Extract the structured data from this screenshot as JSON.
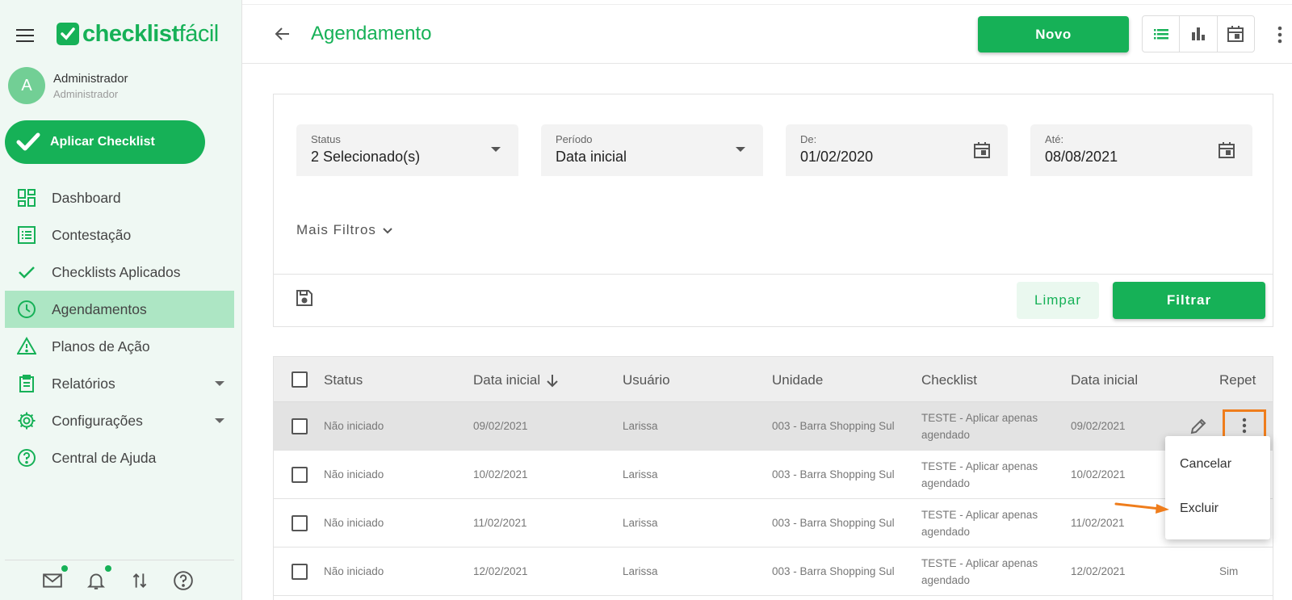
{
  "brand": {
    "name_bold": "checklist",
    "name_thin": "fácil",
    "color": "#16b157"
  },
  "profile": {
    "initial": "A",
    "name": "Administrador",
    "role": "Administrador"
  },
  "apply_button": {
    "label": "Aplicar Checklist"
  },
  "nav": {
    "items": [
      {
        "label": "Dashboard",
        "icon": "dashboard-icon"
      },
      {
        "label": "Contestação",
        "icon": "list-icon"
      },
      {
        "label": "Checklists Aplicados",
        "icon": "check-icon"
      },
      {
        "label": "Agendamentos",
        "icon": "clock-icon",
        "active": true
      },
      {
        "label": "Planos de Ação",
        "icon": "warning-icon"
      },
      {
        "label": "Relatórios",
        "icon": "clipboard-icon",
        "expandable": true
      },
      {
        "label": "Configurações",
        "icon": "gear-icon",
        "expandable": true
      },
      {
        "label": "Central de Ajuda",
        "icon": "help-icon"
      }
    ]
  },
  "header": {
    "title": "Agendamento",
    "new_button": "Novo"
  },
  "filters": {
    "status": {
      "label": "Status",
      "value": "2 Selecionado(s)"
    },
    "periodo": {
      "label": "Período",
      "value": "Data inicial"
    },
    "de": {
      "label": "De:",
      "value": "01/02/2020"
    },
    "ate": {
      "label": "Até:",
      "value": "08/08/2021"
    },
    "more_filters": "Mais Filtros",
    "clear_button": "Limpar",
    "filter_button": "Filtrar"
  },
  "table": {
    "columns": [
      "Status",
      "Data inicial",
      "Usuário",
      "Unidade",
      "Checklist",
      "Data inicial",
      "Repet"
    ],
    "rows": [
      {
        "status": "Não iniciado",
        "date": "09/02/2021",
        "user": "Larissa",
        "unit": "003 - Barra Shopping Sul",
        "checklist_l1": "TESTE - Aplicar apenas",
        "checklist_l2": "agendado",
        "date2": "09/02/2021",
        "repeat": ""
      },
      {
        "status": "Não iniciado",
        "date": "10/02/2021",
        "user": "Larissa",
        "unit": "003 - Barra Shopping Sul",
        "checklist_l1": "TESTE - Aplicar apenas",
        "checklist_l2": "agendado",
        "date2": "10/02/2021",
        "repeat": ""
      },
      {
        "status": "Não iniciado",
        "date": "11/02/2021",
        "user": "Larissa",
        "unit": "003 - Barra Shopping Sul",
        "checklist_l1": "TESTE - Aplicar apenas",
        "checklist_l2": "agendado",
        "date2": "11/02/2021",
        "repeat": ""
      },
      {
        "status": "Não iniciado",
        "date": "12/02/2021",
        "user": "Larissa",
        "unit": "003 - Barra Shopping Sul",
        "checklist_l1": "TESTE - Aplicar apenas",
        "checklist_l2": "agendado",
        "date2": "12/02/2021",
        "repeat": "Sim"
      }
    ]
  },
  "row_menu": {
    "items": [
      "Cancelar",
      "Excluir"
    ]
  },
  "colors": {
    "accent": "#16b157",
    "active_nav": "#ade6c4",
    "highlight": "#ef7d1c"
  }
}
